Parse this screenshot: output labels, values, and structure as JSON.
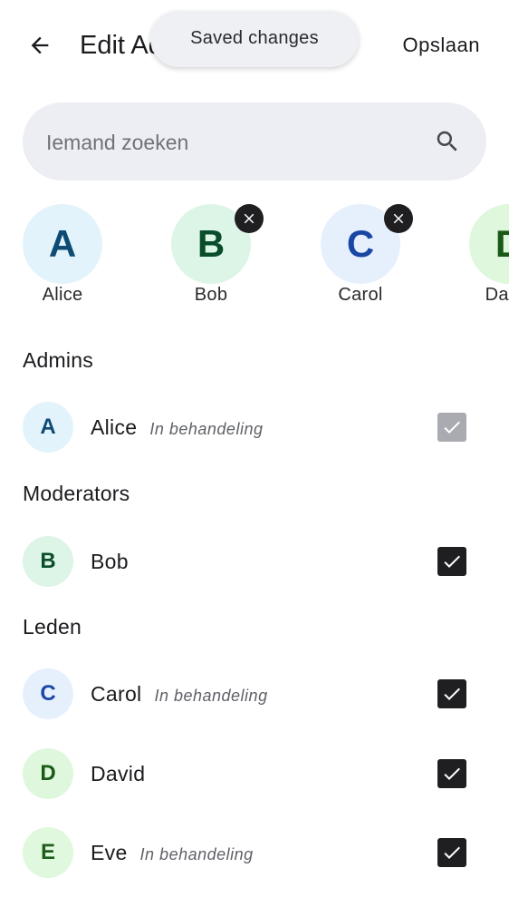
{
  "header": {
    "title": "Edit Admins",
    "save_label": "Opslaan",
    "toast": "Saved changes"
  },
  "search": {
    "placeholder": "Iemand zoeken",
    "value": ""
  },
  "selected_chips": [
    {
      "initial": "A",
      "name": "Alice",
      "removable": false
    },
    {
      "initial": "B",
      "name": "Bob",
      "removable": true
    },
    {
      "initial": "C",
      "name": "Carol",
      "removable": true
    },
    {
      "initial": "D",
      "name": "David",
      "removable": false
    }
  ],
  "sections": [
    {
      "title": "Admins",
      "members": [
        {
          "initial": "A",
          "name": "Alice",
          "status": "In behandeling",
          "checked": true,
          "disabled": true
        }
      ]
    },
    {
      "title": "Moderators",
      "members": [
        {
          "initial": "B",
          "name": "Bob",
          "status": "",
          "checked": true,
          "disabled": false
        }
      ]
    },
    {
      "title": "Leden",
      "members": [
        {
          "initial": "C",
          "name": "Carol",
          "status": "In behandeling",
          "checked": true,
          "disabled": false
        },
        {
          "initial": "D",
          "name": "David",
          "status": "",
          "checked": true,
          "disabled": false
        },
        {
          "initial": "E",
          "name": "Eve",
          "status": "In behandeling",
          "checked": true,
          "disabled": false
        }
      ]
    }
  ],
  "colors": {
    "checkbox_on": "#1f1f22",
    "checkbox_disabled": "#a9abb0",
    "search_bg": "#eceef3",
    "toast_bg": "#eef0f4"
  }
}
